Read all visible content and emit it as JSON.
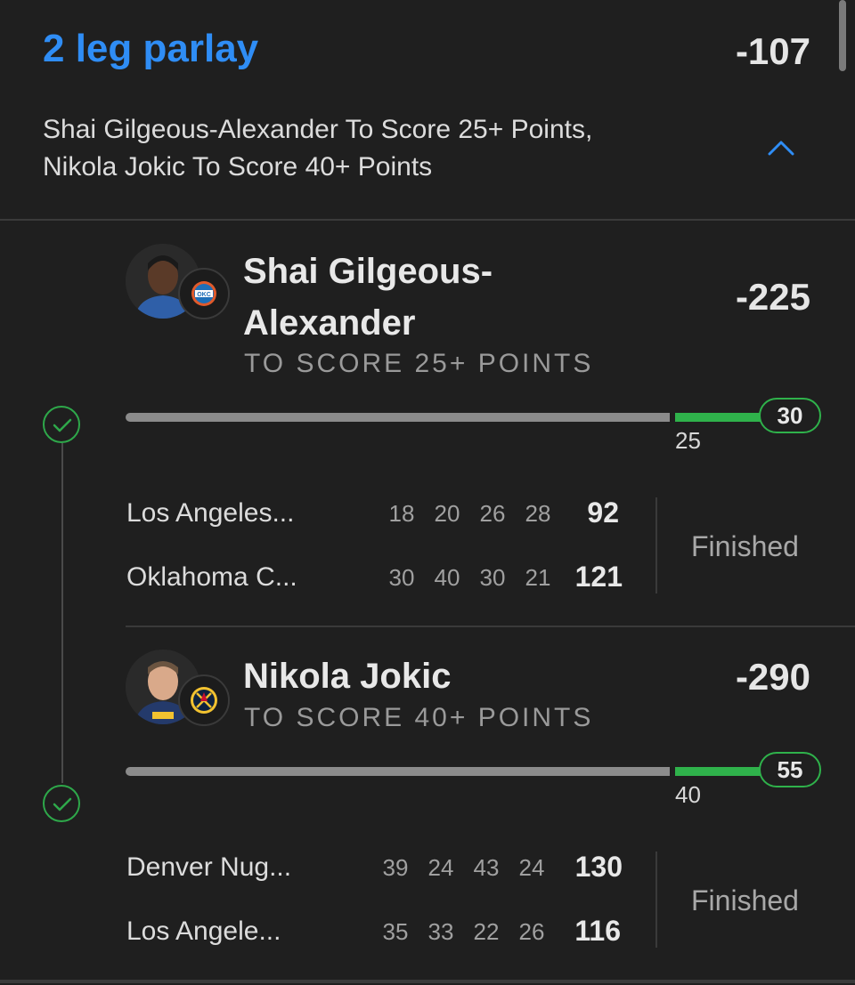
{
  "parlay": {
    "title": "2 leg parlay",
    "odds": "-107",
    "summary_line1": "Shai Gilgeous-Alexander To Score 25+ Points,",
    "summary_line2": "Nikola Jokic To Score 40+ Points"
  },
  "legs": [
    {
      "player_line1": "Shai Gilgeous-",
      "player_line2": "Alexander",
      "prop": "TO SCORE 25+ POINTS",
      "odds": "-225",
      "threshold": "25",
      "actual": "30",
      "team_logo": "okc-logo-icon",
      "game": {
        "teams": [
          {
            "name": "Los Angeles...",
            "quarters": [
              "18",
              "20",
              "26",
              "28"
            ],
            "total": "92"
          },
          {
            "name": "Oklahoma C...",
            "quarters": [
              "30",
              "40",
              "30",
              "21"
            ],
            "total": "121"
          }
        ],
        "status": "Finished"
      }
    },
    {
      "player_line1": "Nikola Jokic",
      "prop": "TO SCORE 40+ POINTS",
      "odds": "-290",
      "threshold": "40",
      "actual": "55",
      "team_logo": "denver-logo-icon",
      "game": {
        "teams": [
          {
            "name": "Denver Nug...",
            "quarters": [
              "39",
              "24",
              "43",
              "24"
            ],
            "total": "130"
          },
          {
            "name": "Los Angele...",
            "quarters": [
              "35",
              "33",
              "22",
              "26"
            ],
            "total": "116"
          }
        ],
        "status": "Finished"
      }
    }
  ],
  "colors": {
    "accent": "#2f8df5",
    "success": "#2fb24b",
    "background": "#1f1f1f"
  }
}
